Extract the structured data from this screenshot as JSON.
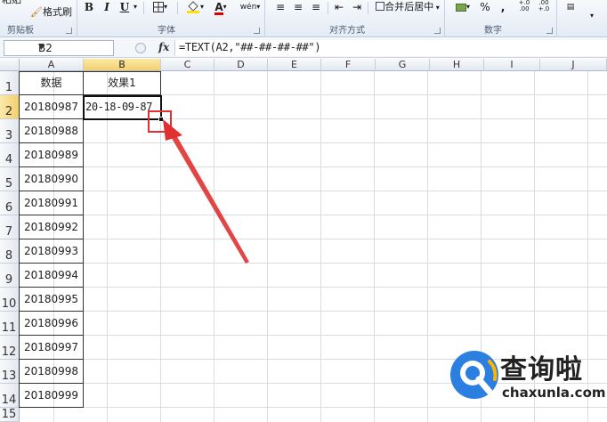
{
  "ribbon": {
    "clipboard": {
      "label": "剪贴板",
      "format_painter": "格式刷"
    },
    "font": {
      "label": "字体",
      "bold": "B",
      "italic": "I",
      "underline": "U",
      "wen": "wén"
    },
    "alignment": {
      "label": "对齐方式",
      "merge": "合并后居中"
    },
    "number": {
      "label": "数字",
      "percent": "%",
      "comma": ",",
      "increase": "+.0 .00",
      "decrease": ".00 +.0"
    },
    "top_left_fragment": "粘贴"
  },
  "formula_bar": {
    "name_box": "B2",
    "fx": "fx",
    "formula": "=TEXT(A2,\"##-##-##-##\")"
  },
  "grid": {
    "columns": [
      "A",
      "B",
      "C",
      "D",
      "E",
      "F",
      "G",
      "H",
      "I",
      "J"
    ],
    "rows": [
      "1",
      "2",
      "3",
      "4",
      "5",
      "6",
      "7",
      "8",
      "9",
      "10",
      "11",
      "12",
      "13",
      "14",
      "15"
    ],
    "selected_column": "B",
    "selected_row": "2",
    "header_a": "数据",
    "header_b": "效果1",
    "col_a_values": [
      "20180987",
      "20180988",
      "20180989",
      "20180990",
      "20180991",
      "20180992",
      "20180993",
      "20180994",
      "20180995",
      "20180996",
      "20180997",
      "20180998",
      "20180999"
    ],
    "b2_value": "20-18-09-87"
  },
  "annotation": {
    "color": "#e03030"
  },
  "watermark": {
    "text": "查询啦",
    "url": "chaxunla.com",
    "brand_color": "#2a7fe0"
  }
}
